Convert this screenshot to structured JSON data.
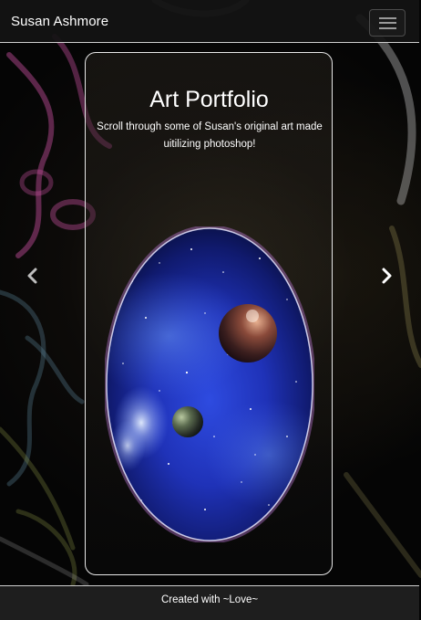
{
  "navbar": {
    "brand": "Susan Ashmore",
    "toggler_icon": "hamburger-menu-icon"
  },
  "carousel": {
    "prev_icon": "chevron-left-icon",
    "next_icon": "chevron-right-icon"
  },
  "card": {
    "title": "Art Portfolio",
    "subtitle": "Scroll through some of Susan's original art made uitilizing photoshop!",
    "image_subject": "space-planets-artwork"
  },
  "footer": {
    "text": "Created with ~Love~"
  },
  "colors": {
    "navbar_bg": "#141414",
    "footer_bg": "#1e1e1e",
    "card_border": "#e8e8e8",
    "text": "#ffffff"
  }
}
